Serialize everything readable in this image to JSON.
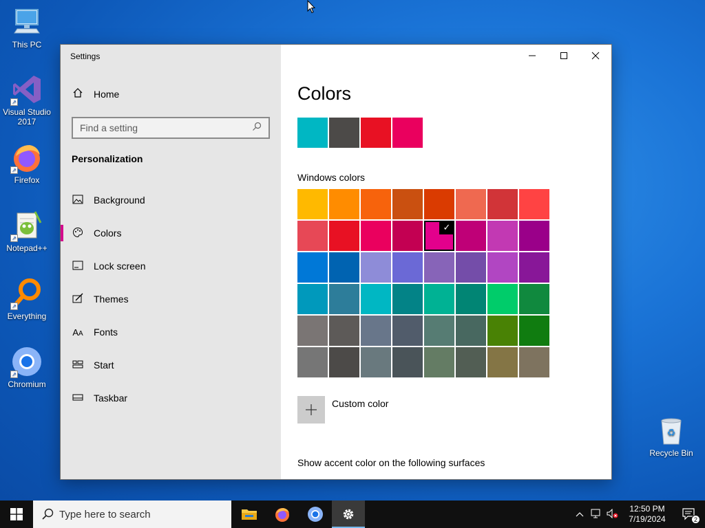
{
  "desktop": {
    "icons": [
      {
        "label": "This PC"
      },
      {
        "label": "Visual Studio 2017"
      },
      {
        "label": "Firefox"
      },
      {
        "label": "Notepad++"
      },
      {
        "label": "Everything"
      },
      {
        "label": "Chromium"
      },
      {
        "label": "Recycle Bin"
      }
    ]
  },
  "window": {
    "title": "Settings",
    "controls": {
      "minimize": "—",
      "maximize": "☐",
      "close": "✕"
    }
  },
  "sidebar": {
    "home_label": "Home",
    "search_placeholder": "Find a setting",
    "section_title": "Personalization",
    "items": [
      {
        "label": "Background",
        "icon": "picture-icon"
      },
      {
        "label": "Colors",
        "icon": "palette-icon",
        "active": true
      },
      {
        "label": "Lock screen",
        "icon": "lock-screen-icon"
      },
      {
        "label": "Themes",
        "icon": "brush-icon"
      },
      {
        "label": "Fonts",
        "icon": "font-icon"
      },
      {
        "label": "Start",
        "icon": "start-layout-icon"
      },
      {
        "label": "Taskbar",
        "icon": "taskbar-icon"
      }
    ]
  },
  "main": {
    "title": "Colors",
    "recent_colors": [
      "#00b7c3",
      "#4c4a48",
      "#e81123",
      "#ea005e"
    ],
    "windows_colors_label": "Windows colors",
    "palette": [
      "#ffb900",
      "#ff8c00",
      "#f7630c",
      "#ca5010",
      "#da3b01",
      "#ef6950",
      "#d13438",
      "#ff4343",
      "#e74856",
      "#e81123",
      "#ea005e",
      "#c30052",
      "#e3008c",
      "#bf0077",
      "#c239b3",
      "#9a0089",
      "#0078d7",
      "#0063b1",
      "#8e8cd8",
      "#6b69d6",
      "#8764b8",
      "#744da9",
      "#b146c2",
      "#881798",
      "#0099bc",
      "#2d7d9a",
      "#00b7c3",
      "#038387",
      "#00b294",
      "#018574",
      "#00cc6a",
      "#10893e",
      "#7a7574",
      "#5d5a58",
      "#68768a",
      "#515c6b",
      "#567c73",
      "#486860",
      "#498205",
      "#107c10",
      "#767676",
      "#4c4a48",
      "#69797e",
      "#4a5459",
      "#647c64",
      "#525e54",
      "#847545",
      "#7e735f"
    ],
    "selected_index": 12,
    "custom_color_label": "Custom color",
    "surfaces_label": "Show accent color on the following surfaces"
  },
  "taskbar": {
    "search_placeholder": "Type here to search",
    "apps": [
      "file-explorer-icon",
      "firefox-icon",
      "chromium-icon",
      "settings-icon"
    ],
    "clock_time": "12:50 PM",
    "clock_date": "7/19/2024",
    "notification_count": "2"
  }
}
